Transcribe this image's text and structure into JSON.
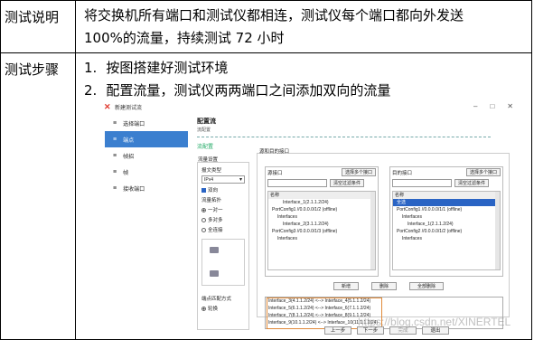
{
  "rows": [
    {
      "label": "测试说明",
      "lines": [
        "将交换机所有端口和测试仪都相连，测试仪每个端口都向外发送",
        "100%的流量，持续测试 72 小时"
      ]
    },
    {
      "label": "测试步骤",
      "steps": [
        {
          "num": "1.",
          "text": "按图搭建好测试环境"
        },
        {
          "num": "2.",
          "text": "配置流量，测试仪两两端口之间添加双向的流量"
        }
      ]
    }
  ],
  "screenshot": {
    "app_title": "新建测试流",
    "sidebar": [
      "选择端口",
      "端点",
      "帧招",
      "帧",
      "接收端口"
    ],
    "active_index": 1,
    "main_title": "配置流",
    "main_subtitle": "流配置",
    "flow_cfg": "流配置",
    "left_panel": {
      "group_label": "流量设置",
      "type_label": "报文类型",
      "type_value": "IPv4",
      "bidir": "双向",
      "topo_label": "流量拓扑",
      "topo_options": [
        "一对一",
        "多对多",
        "全连接"
      ],
      "mode_label": "端点匹配方式",
      "mode_value": "轮换"
    },
    "right_panel": {
      "title": "源和目的接口",
      "src_label": "源接口",
      "dst_label": "目的接口",
      "select_multi": "选择多个接口",
      "clear_filter": "清空过滤条件",
      "name_col": "名称",
      "src_tree": [
        "Interface_1(2.1.1.2/24)",
        "PortConfig1 //0.0.0.0/1/2 (offline)",
        "Interfaces",
        "Interface_2(3.1.1.2/24)",
        "PortConfig3 //0.0.0.0/1/3 (offline)",
        "Interfaces"
      ],
      "dst_tree": [
        "全选",
        "PortConfig1 //0.0.0.0/1/1 (offline)",
        "Interfaces",
        "Interface_1(2.1.1.2/24)",
        "PortConfig2 //0.0.0.0/1/2 (offline)",
        "Interfaces"
      ],
      "btn_new": "新增",
      "btn_delete": "删除",
      "btn_delete_all": "全部删除",
      "pairs": [
        "Interface_3(4.1.1.2/24) <--> Interface_4(5.1.1.2/24)",
        "Interface_5(6.1.1.2/24) <--> Interface_6(7.1.1.2/24)",
        "Interface_7(8.1.1.2/24) <--> Interface_8(9.1.1.2/24)",
        "Interface_9(10.1.1.2/24) <--> Interface_10(11.1.1.2/24)"
      ]
    },
    "footer": [
      "上一步",
      "下一步",
      "完成",
      "退出"
    ]
  },
  "watermark": "https://blog.csdn.net/XINERTEL"
}
